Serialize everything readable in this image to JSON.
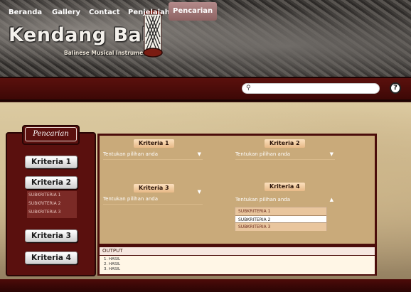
{
  "header": {
    "logo_title": "Kendang Bali",
    "logo_subtitle": "Balinese Musical Instrument"
  },
  "nav": {
    "items": [
      {
        "label": "Beranda"
      },
      {
        "label": "Gallery"
      },
      {
        "label": "Contact"
      },
      {
        "label": "Penjelajah"
      },
      {
        "label": "Pencarian"
      }
    ],
    "active": "Pencarian",
    "search_placeholder": "",
    "help_label": "?"
  },
  "sidebar": {
    "title": "Pencarian",
    "buttons": [
      {
        "label": "Kriteria 1"
      },
      {
        "label": "Kriteria 2"
      },
      {
        "label": "Kriteria 3"
      },
      {
        "label": "Kriteria 4"
      }
    ],
    "subitems": [
      "SUBKRITERIA 1",
      "SUBKRITERIA 2",
      "SUBKRITERIA 3"
    ]
  },
  "criteria": [
    {
      "label": "Kriteria 1",
      "select_text": "Tentukan pilihan anda"
    },
    {
      "label": "Kriteria 2",
      "select_text": "Tentukan pilihan anda"
    },
    {
      "label": "Kriteria 3",
      "select_text": "Tentukan pilihan anda"
    },
    {
      "label": "Kriteria 4",
      "select_text": "Tentukan pilihan anda"
    }
  ],
  "dropdown_options": [
    "SUBKRITERIA 1",
    "SUBKRITERIA 2",
    "SUBKRITERIA 3"
  ],
  "output": {
    "title": "OUTPUT",
    "lines": [
      "1. HASIL",
      "2. HASIL",
      "3. HASIL"
    ]
  },
  "colors": {
    "nav_bg": "#4a0c0a",
    "panel_bg": "#c9aa7a",
    "sidebar_bg": "#5a100e",
    "accent_label": "#f2c79a"
  }
}
